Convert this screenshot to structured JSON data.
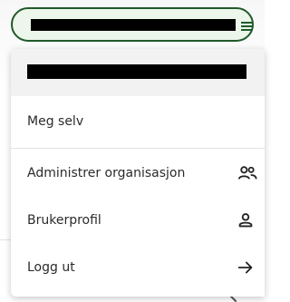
{
  "menu": {
    "items": [
      {
        "label": "Meg selv",
        "icon": "none"
      },
      {
        "label": "Administrer organisasjon",
        "icon": "group-icon"
      },
      {
        "label": "Brukerprofil",
        "icon": "person-icon"
      },
      {
        "label": "Logg ut",
        "icon": "arrow-right-icon"
      }
    ]
  },
  "colors": {
    "accent": "#1f5a2a",
    "button_bg": "#edf6ea",
    "header_bg": "#f2f2f2",
    "text": "#2b2b2b"
  }
}
